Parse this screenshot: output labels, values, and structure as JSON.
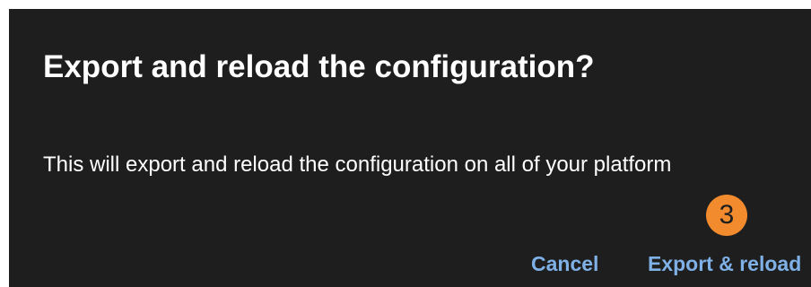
{
  "dialog": {
    "title": "Export and reload the configuration?",
    "message": "This will export and reload the configuration on all of your platform",
    "step_badge": "3",
    "cancel_label": "Cancel",
    "confirm_label": "Export & reload"
  },
  "colors": {
    "dialog_background": "#1e1e1e",
    "text": "#ffffff",
    "button_text": "#7fb0e6",
    "badge_background": "#f28a2e"
  }
}
